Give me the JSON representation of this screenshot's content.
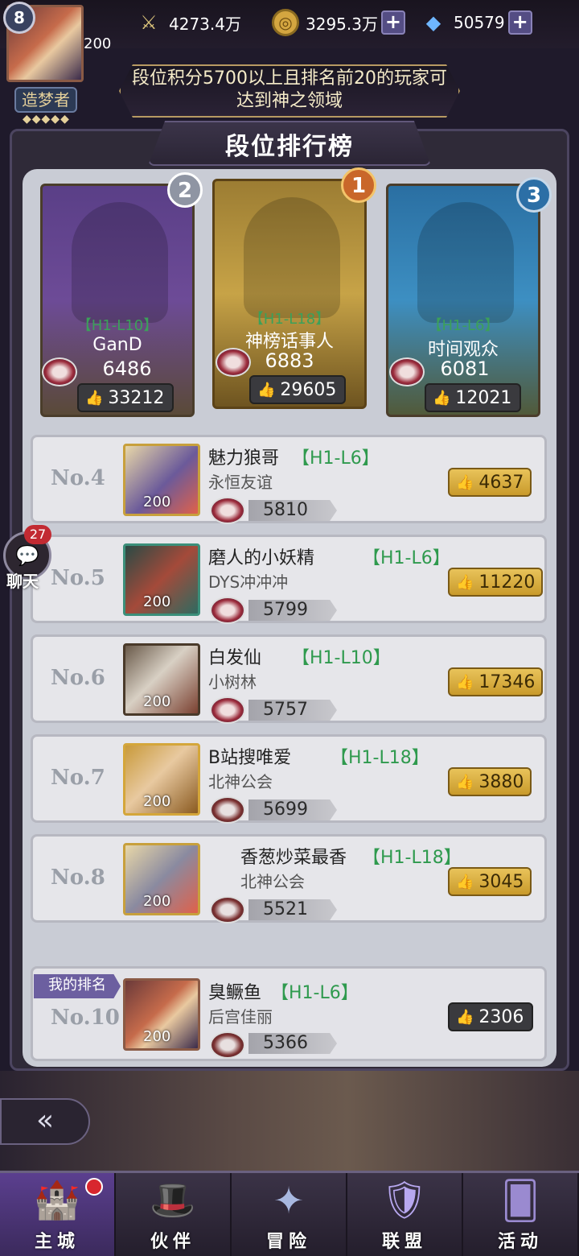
{
  "topbar": {
    "player_level": "8",
    "player_badge_level": "200",
    "player_title": "造梦者",
    "player_stars": "◆◆◆◆◆",
    "power_value": "4273.4万",
    "gold_value": "3295.3万",
    "gem_value": "50579"
  },
  "banner": {
    "text": "段位积分5700以上且排名前20的玩家可达到神之领域"
  },
  "header": {
    "title": "段位排行榜"
  },
  "podium": [
    {
      "rank": "2",
      "level": "【H1-L10】",
      "name": "GanD",
      "score": "6486",
      "likes": "33212"
    },
    {
      "rank": "1",
      "level": "【H1-L18】",
      "name": "神榜话事人",
      "score": "6883",
      "likes": "29605"
    },
    {
      "rank": "3",
      "level": "【H1-L6】",
      "name": "时间观众",
      "score": "6081",
      "likes": "12021"
    }
  ],
  "rows": [
    {
      "rank": "No.4",
      "name": "魅力狼哥",
      "level": "【H1-L6】",
      "guild": "永恒友谊",
      "score": "5810",
      "likes": "4637",
      "avatar_level": "200"
    },
    {
      "rank": "No.5",
      "name": "磨人的小妖精",
      "level": "【H1-L6】",
      "guild": "DYS冲冲冲",
      "score": "5799",
      "likes": "11220",
      "avatar_level": "200"
    },
    {
      "rank": "No.6",
      "name": "白发仙",
      "level": "【H1-L10】",
      "guild": "小树林",
      "score": "5757",
      "likes": "17346",
      "avatar_level": "200"
    },
    {
      "rank": "No.7",
      "name": "B站搜唯爱",
      "level": "【H1-L18】",
      "guild": "北神公会",
      "score": "5699",
      "likes": "3880",
      "avatar_level": "200"
    },
    {
      "rank": "No.8",
      "name": "香葱炒菜最香",
      "level": "【H1-L18】",
      "guild": "北神公会",
      "score": "5521",
      "likes": "3045",
      "avatar_level": "200"
    }
  ],
  "my_rank": {
    "tag": "我的排名",
    "rank": "No.10",
    "name": "臭鳜鱼",
    "level": "【H1-L6】",
    "guild": "后宫佳丽",
    "score": "5366",
    "likes": "2306",
    "avatar_level": "200"
  },
  "chat": {
    "badge": "27",
    "label": "聊天"
  },
  "nav": [
    {
      "label": "主城",
      "icon": "castle-icon"
    },
    {
      "label": "伙伴",
      "icon": "witch-hat-icon"
    },
    {
      "label": "冒险",
      "icon": "compass-icon"
    },
    {
      "label": "联盟",
      "icon": "shield-icon"
    },
    {
      "label": "活动",
      "icon": "cards-icon"
    }
  ]
}
